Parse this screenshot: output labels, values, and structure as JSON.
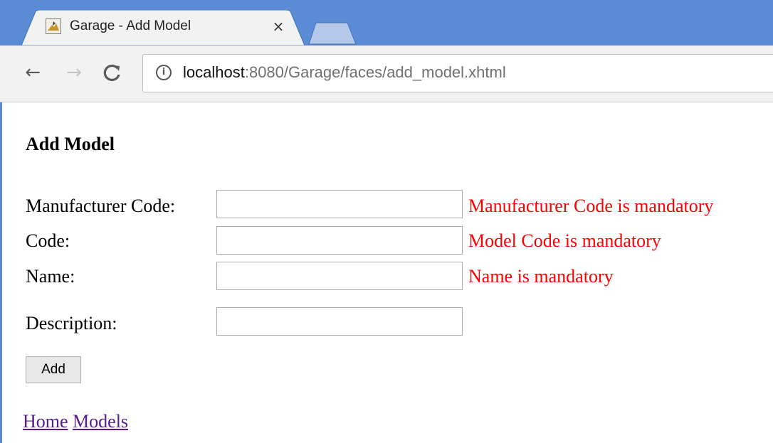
{
  "browser": {
    "tab_title": "Garage - Add Model",
    "tab_close_glyph": "×",
    "back_glyph": "←",
    "forward_glyph": "→",
    "reload_glyph": "C",
    "info_glyph": "i",
    "url_host": "localhost",
    "url_rest": ":8080/Garage/faces/add_model.xhtml",
    "favicon": "garage-favicon",
    "icons": [
      "back-arrow-icon",
      "forward-arrow-icon",
      "reload-icon",
      "info-icon",
      "close-icon"
    ],
    "colors": {
      "tabstrip": "#5b8bd4",
      "toolbar": "#f2f2f2"
    }
  },
  "page": {
    "heading": "Add Model",
    "form": {
      "manufacturer_code": {
        "label": "Manufacturer Code:",
        "value": "",
        "error": "Manufacturer Code is mandatory"
      },
      "code": {
        "label": "Code:",
        "value": "",
        "error": "Model Code is mandatory"
      },
      "name": {
        "label": "Name:",
        "value": "",
        "error": "Name is mandatory"
      },
      "description": {
        "label": "Description:",
        "value": ""
      }
    },
    "submit_label": "Add",
    "links": {
      "home": "Home",
      "models": "Models"
    },
    "colors": {
      "error": "#ff0000",
      "link": "#551a8b"
    }
  }
}
